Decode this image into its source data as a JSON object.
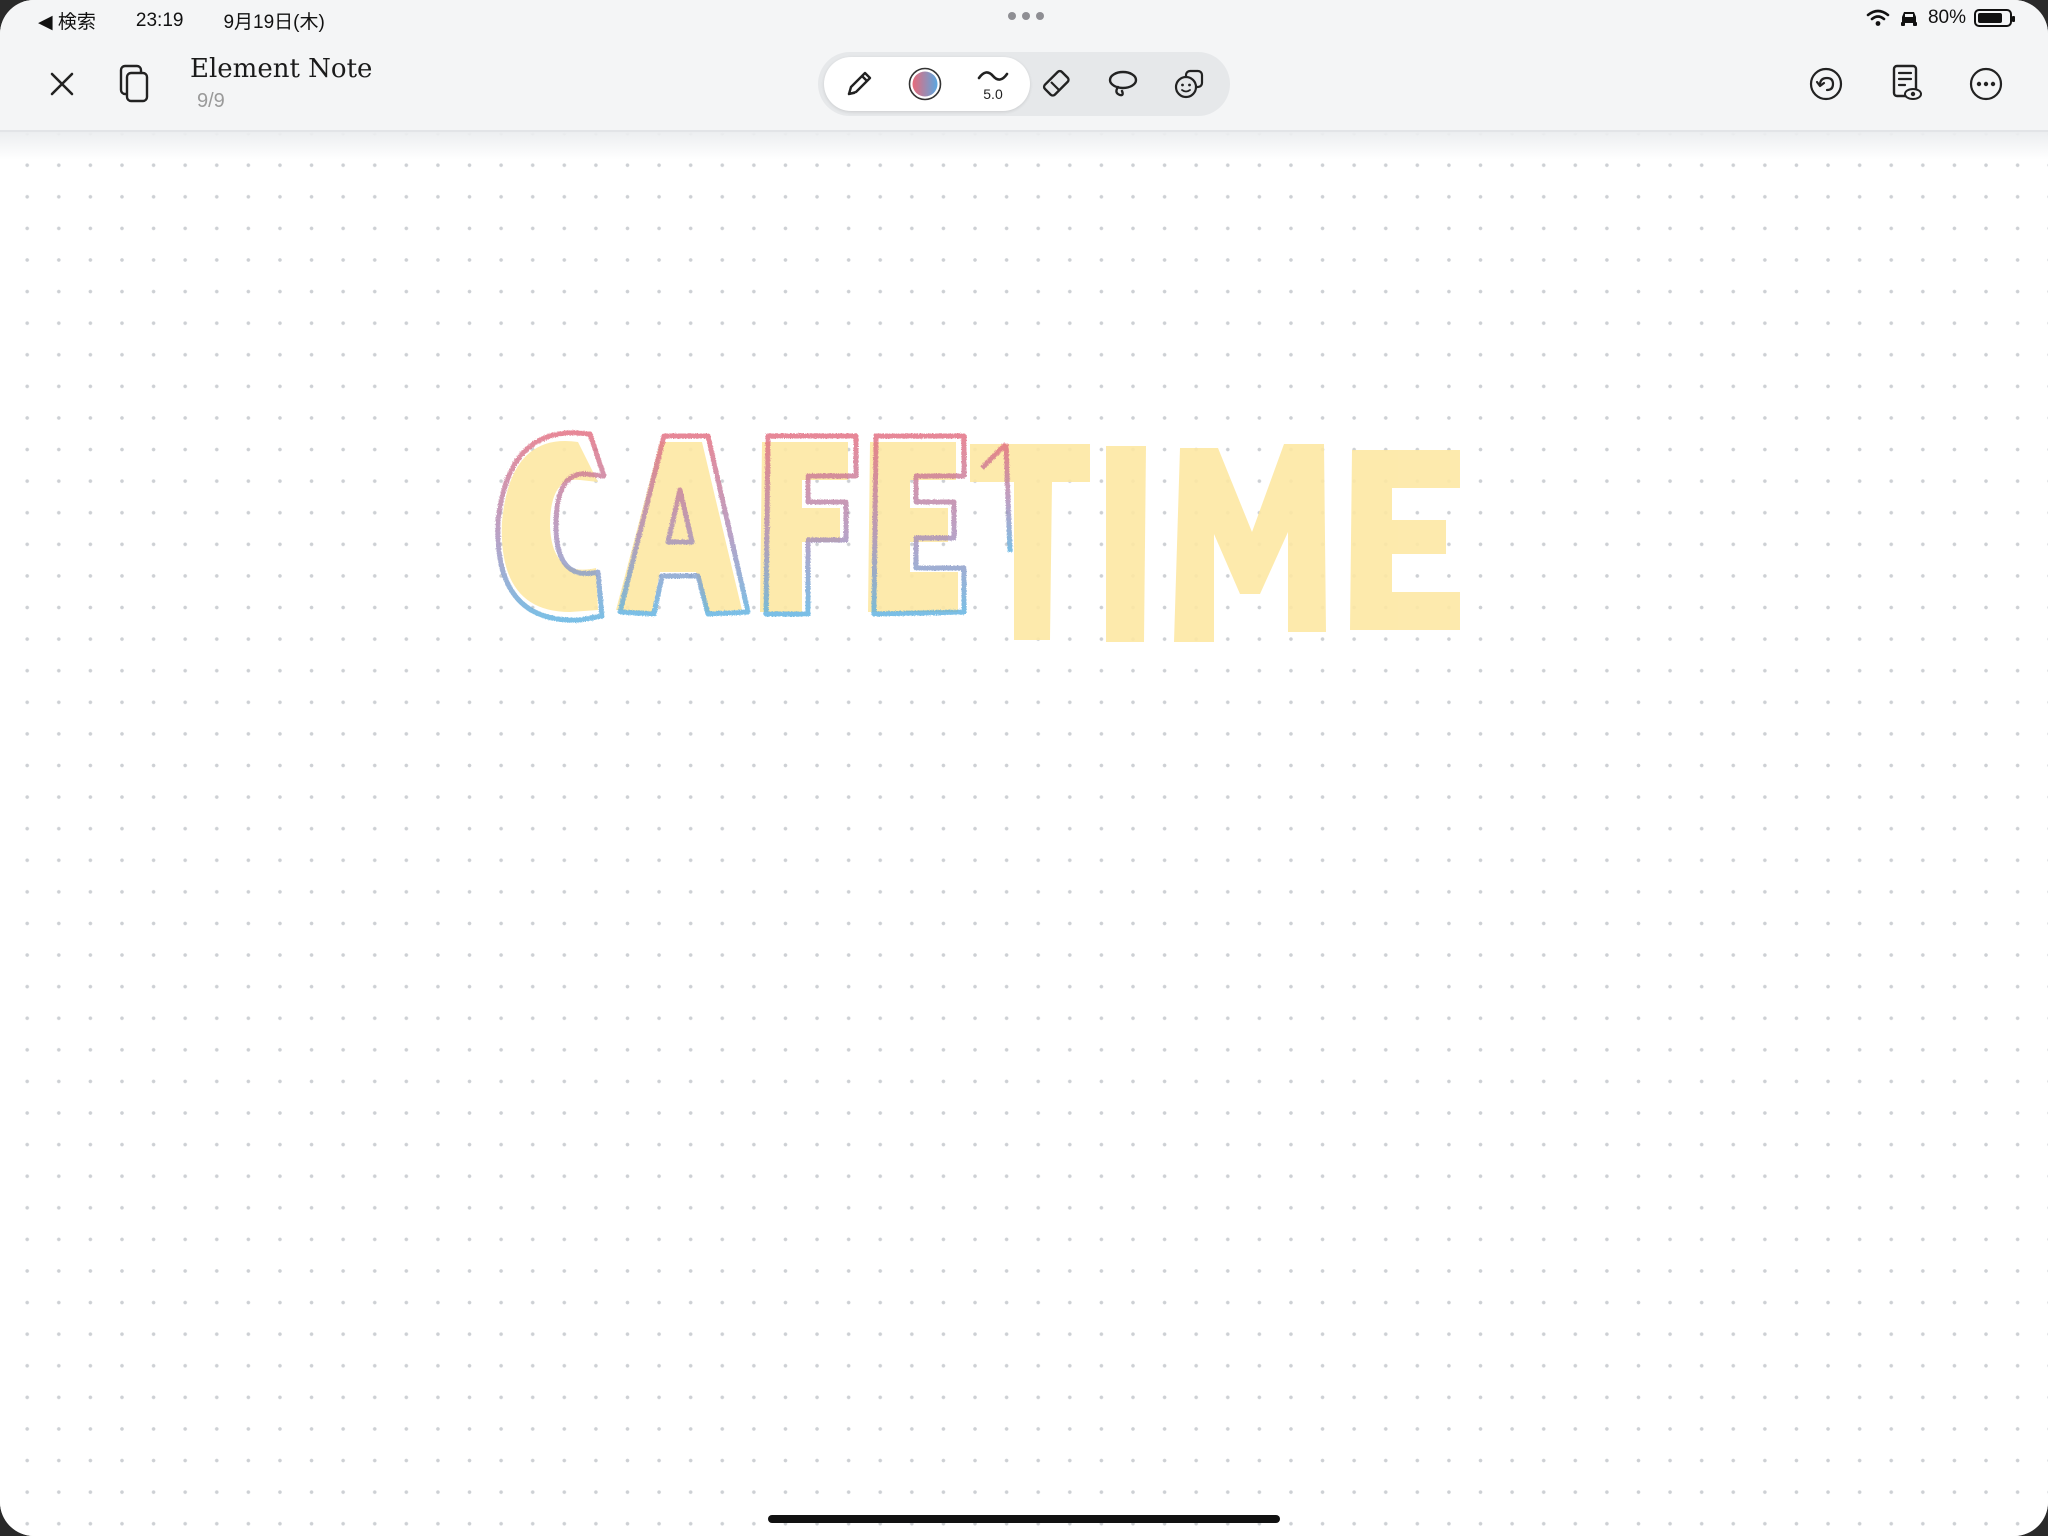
{
  "status_bar": {
    "back_label": "◀ 検索",
    "time": "23:19",
    "date": "9月19日(木)",
    "battery_text": "80%",
    "battery_level": 0.8
  },
  "toolbar": {
    "title": "Element Note",
    "page_count": "9/9",
    "stroke_size": "5.0",
    "pen_color_start": "#e86a7a",
    "pen_color_end": "#5aa7e0"
  },
  "canvas": {
    "handwriting_text": "CAFETIME",
    "fill_color": "#fde8a4"
  },
  "icons": {
    "close": "close-icon",
    "pages": "pages-icon",
    "pen": "pencil-icon",
    "color": "color-swatch-icon",
    "stroke": "stroke-size-icon",
    "eraser": "eraser-icon",
    "lasso": "lasso-icon",
    "stickers": "sticker-icon",
    "undo": "undo-icon",
    "document": "document-view-icon",
    "more": "more-icon"
  }
}
